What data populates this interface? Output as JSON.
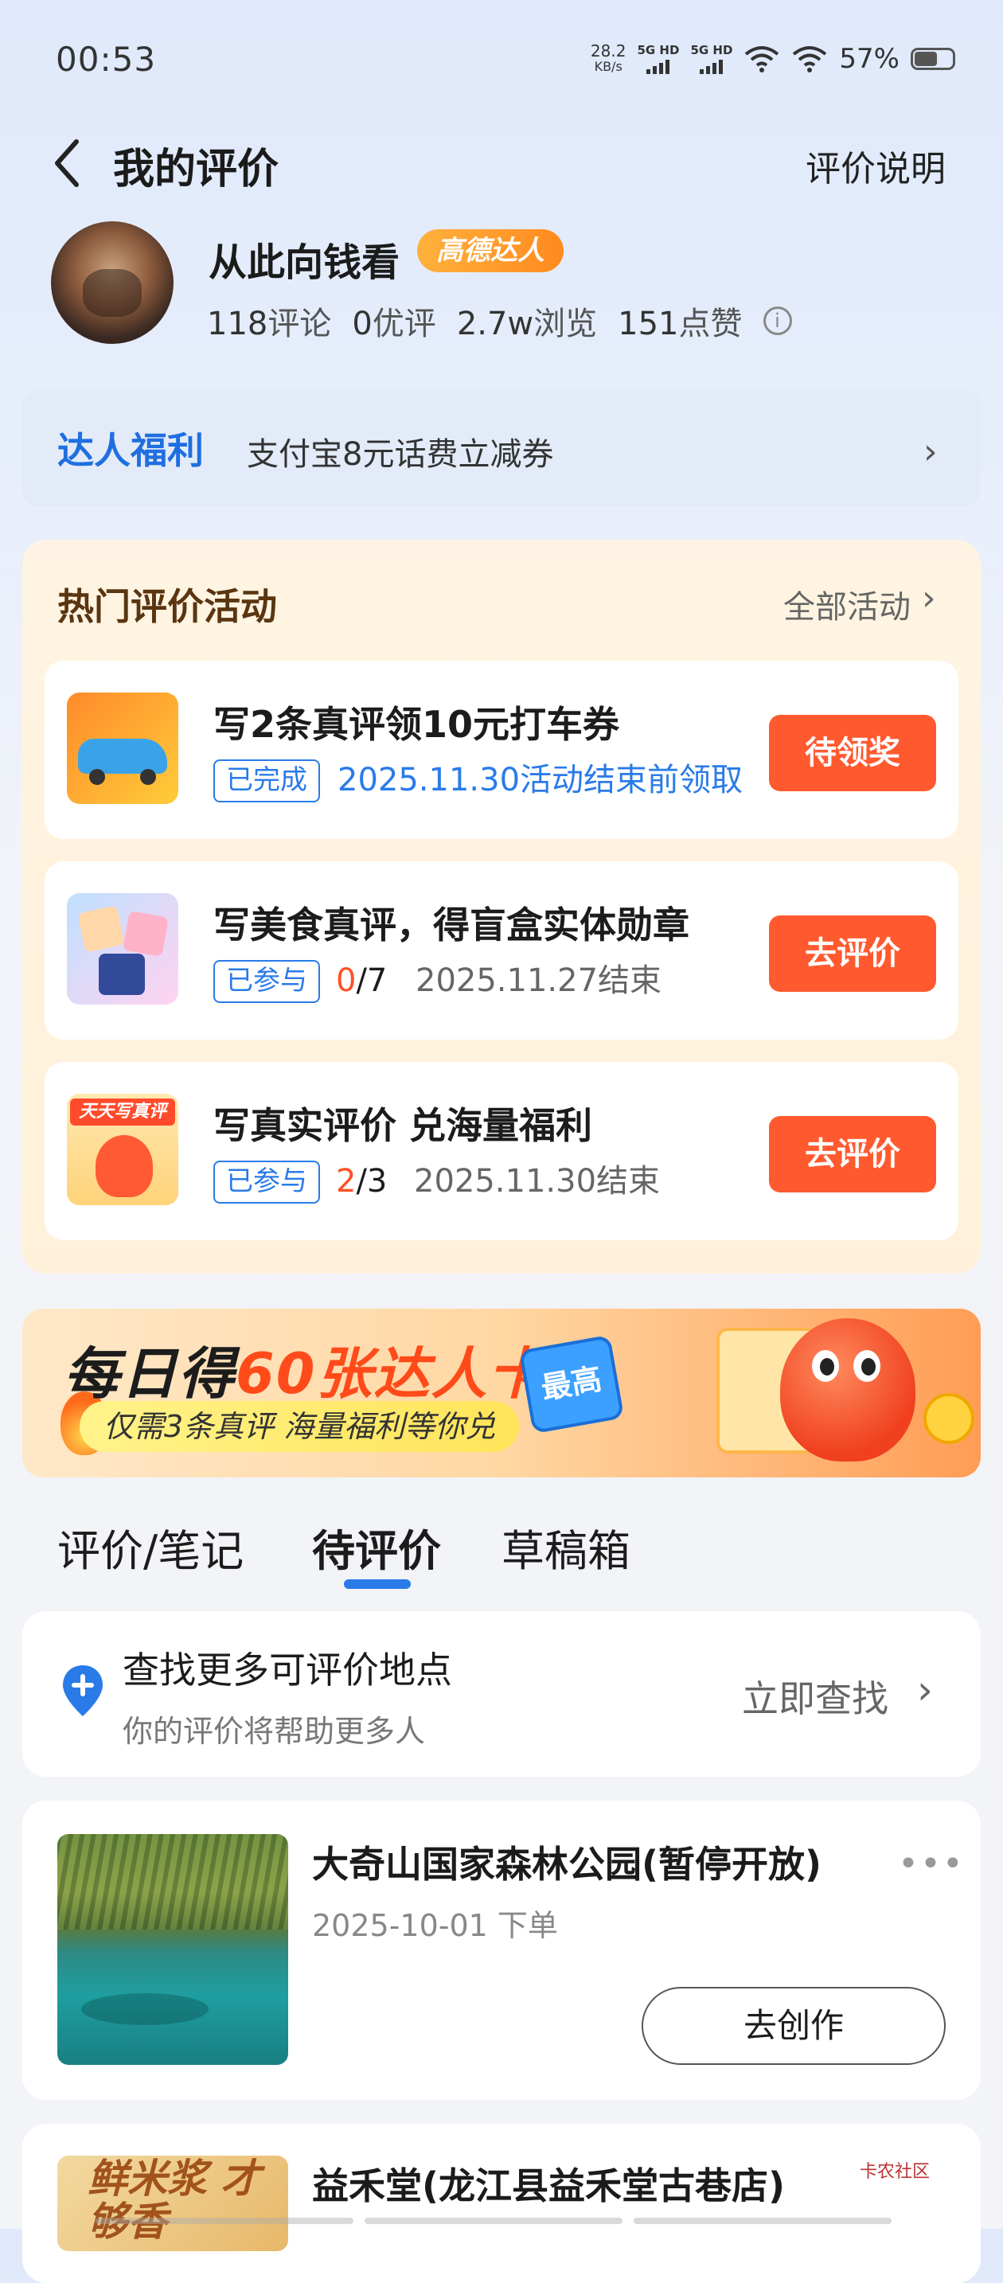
{
  "status_bar": {
    "time": "00:53",
    "speed_value": "28.2",
    "speed_unit": "KB/s",
    "sim1": "5G HD",
    "sim2": "5G HD",
    "battery": "57%"
  },
  "header": {
    "title": "我的评价",
    "link": "评价说明"
  },
  "profile": {
    "name": "从此向钱看",
    "badge": "高德达人",
    "stats": [
      {
        "value": "118",
        "label": "评论"
      },
      {
        "value": "0",
        "label": "优评"
      },
      {
        "value": "2.7w",
        "label": "浏览"
      },
      {
        "value": "151",
        "label": "点赞"
      }
    ]
  },
  "welfare": {
    "title": "达人福利",
    "text": "支付宝8元话费立减券"
  },
  "activities": {
    "title": "热门评价活动",
    "all_link": "全部活动",
    "items": [
      {
        "title": "写2条真评领10元打车券",
        "tag": "已完成",
        "desc": "2025.11.30活动结束前领取",
        "button": "待领奖"
      },
      {
        "title": "写美食真评，得盲盒实体勋章",
        "tag": "已参与",
        "progress_done": "0",
        "progress_total": "/7",
        "desc": "2025.11.27结束",
        "button": "去评价"
      },
      {
        "title": "写真实评价 兑海量福利",
        "tag": "已参与",
        "progress_done": "2",
        "progress_total": "/3",
        "desc": "2025.11.30结束",
        "button": "去评价",
        "thumb_text": "天天写真评"
      }
    ]
  },
  "banner": {
    "main_a": "每日得",
    "main_b": "60张达人卡",
    "sticker": "最高",
    "sub": "仅需3条真评 海量福利等你兑"
  },
  "tabs": [
    {
      "label": "评价/笔记"
    },
    {
      "label": "待评价"
    },
    {
      "label": "草稿箱"
    }
  ],
  "find": {
    "title": "查找更多可评价地点",
    "subtitle": "你的评价将帮助更多人",
    "link": "立即查找"
  },
  "orders": [
    {
      "title": "大奇山国家森林公园(暂停开放)",
      "date": "2025-10-01 下单",
      "button": "去创作"
    },
    {
      "title": "益禾堂(龙江县益禾堂古巷店)",
      "photo_text": "鲜米浆 才够香"
    }
  ],
  "watermark": "卡农社区",
  "colors": {
    "accent_blue": "#2a7be8",
    "action_orange": "#ff5a2f",
    "badge_orange": "#ff9a2a"
  }
}
